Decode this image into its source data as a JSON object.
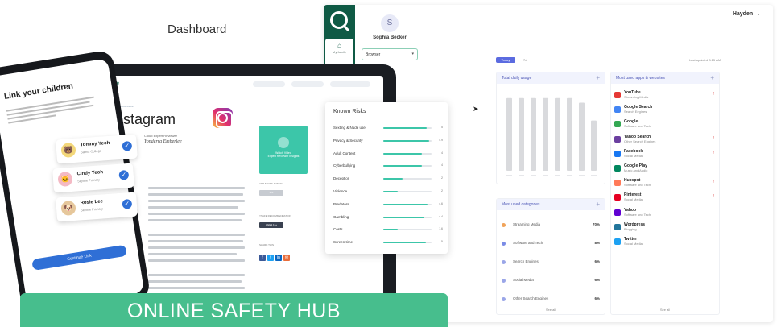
{
  "banner": {
    "text": "ONLINE SAFETY HUB"
  },
  "dashboard": {
    "title": "Dashboard",
    "user": "Hayden",
    "user_chevron": "⌄",
    "rail": {
      "home_icon": "⌂",
      "home_label": "My family"
    },
    "child": {
      "initial": "S",
      "name": "Sophia Becker",
      "browser_select": "Browser"
    },
    "tabs": {
      "today": "Today",
      "seven_days": "7d"
    },
    "last_updated": "Last updated 8:15 AM",
    "usage": {
      "title": "Total daily usage",
      "plus": "+"
    },
    "apps": {
      "title": "Most used apps & websites",
      "plus": "+",
      "see_all": "See all",
      "items": [
        {
          "name": "YouTube",
          "category": "Streaming Media",
          "flag": "!"
        },
        {
          "name": "Google Search",
          "category": "Search Engines",
          "flag": ""
        },
        {
          "name": "Google",
          "category": "Software and Tech",
          "flag": ""
        },
        {
          "name": "Yahoo Search",
          "category": "Other Search Engines",
          "flag": "!"
        },
        {
          "name": "Facebook",
          "category": "Social Media",
          "flag": "!"
        },
        {
          "name": "Google Play",
          "category": "Music and Audio",
          "flag": ""
        },
        {
          "name": "Hubspot",
          "category": "Software and Tech",
          "flag": "!"
        },
        {
          "name": "Pinterest",
          "category": "Social Media",
          "flag": "!"
        },
        {
          "name": "Yahoo",
          "category": "Software and Tech",
          "flag": ""
        },
        {
          "name": "Wordpress",
          "category": "Blogging",
          "flag": ""
        },
        {
          "name": "Twitter",
          "category": "Social Media",
          "flag": ""
        }
      ]
    },
    "categories": {
      "title": "Most used categories",
      "plus": "+",
      "see_all": "See all",
      "items": [
        {
          "name": "Streaming Media",
          "pct": "70%"
        },
        {
          "name": "Software and Tech",
          "pct": "8%"
        },
        {
          "name": "Search Engines",
          "pct": "6%"
        },
        {
          "name": "Social Media",
          "pct": "6%"
        },
        {
          "name": "Other Search Engines",
          "pct": "6%"
        }
      ]
    },
    "colors": {
      "rail": "#0f5a45",
      "accent": "#5b6be0",
      "card_head": "#f1f3fd"
    }
  },
  "tablet": {
    "brand": "ySafe",
    "breadcrumb": "Apps > Social Media",
    "app_title": "Instagram",
    "reviewer_label": "Cloud Expert Reviewer",
    "reviewer_name": "Yonderra Emberlee",
    "video_label": "Watch Video",
    "video_sub": "Expert Reviewer Insights",
    "age_rating_label": "APP STORE RATING",
    "age_rating": "12+",
    "recommendation_label": "YSAFE RECOMMENDATION",
    "recommendation": "AGES 16+",
    "share_label": "SHARE THIS",
    "known_risks": {
      "title": "Known Risks",
      "items": [
        {
          "name": "Sexting & Nude use",
          "value": "5",
          "level": 0.9
        },
        {
          "name": "Privacy & Security",
          "value": "4.9",
          "level": 0.95
        },
        {
          "name": "Adult Content",
          "value": "4",
          "level": 0.8
        },
        {
          "name": "Cyberbullying",
          "value": "4",
          "level": 0.8
        },
        {
          "name": "Deception",
          "value": "2",
          "level": 0.4
        },
        {
          "name": "Violence",
          "value": "2",
          "level": 0.3
        },
        {
          "name": "Predators",
          "value": "4.6",
          "level": 0.92
        },
        {
          "name": "Gambling",
          "value": "4.4",
          "level": 0.85
        },
        {
          "name": "Costs",
          "value": "1.6",
          "level": 0.3
        },
        {
          "name": "Screen time",
          "value": "5",
          "level": 0.88
        }
      ]
    }
  },
  "phone": {
    "title": "Link your children",
    "button": "Continue Link",
    "children": [
      {
        "name": "Tommy Yeoh",
        "school": "Saints College",
        "emoji": "🐻"
      },
      {
        "name": "Cindy Yeoh",
        "school": "Skyline Primary",
        "emoji": "🐱"
      },
      {
        "name": "Rosie Lee",
        "school": "Skyline Primary",
        "emoji": "🐶"
      }
    ],
    "check_glyph": "✓"
  },
  "chart_data": {
    "type": "bar",
    "title": "Total daily usage",
    "categories": [
      "",
      "",
      "",
      "",
      "",
      "",
      "",
      ""
    ],
    "values": [
      0.94,
      0.94,
      0.94,
      0.94,
      0.94,
      0.94,
      0.88,
      0.65
    ]
  }
}
